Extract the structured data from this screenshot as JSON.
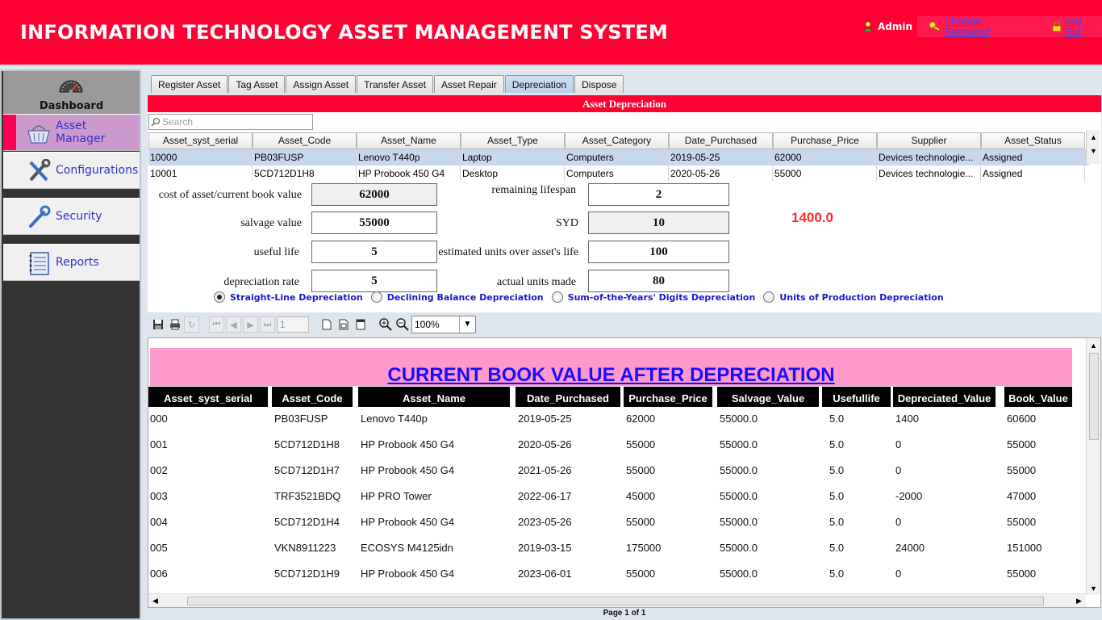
{
  "header": {
    "title": "INFORMATION TECHNOLOGY ASSET MANAGEMENT SYSTEM",
    "user": "Admin",
    "change_password": "Change Password",
    "logout": "Log Out",
    "bg_color": "#ff0033"
  },
  "sidebar": {
    "dashboard": "Dashboard",
    "items": [
      {
        "label": "Asset Manager",
        "icon": "basket-icon",
        "active": true
      },
      {
        "label": "Configurations",
        "icon": "tools-icon",
        "active": false
      },
      {
        "label": "Security",
        "icon": "wrench-icon",
        "active": false
      },
      {
        "label": "Reports",
        "icon": "notebook-icon",
        "active": false
      }
    ]
  },
  "tabs": [
    "Register Asset",
    "Tag Asset",
    "Assign Asset",
    "Transfer Asset",
    "Asset Repair",
    "Depreciation",
    "Dispose"
  ],
  "active_tab": "Depreciation",
  "banner": "Asset Depreciation",
  "search": {
    "placeholder": "Search"
  },
  "asset_table": {
    "columns": [
      "Asset_syst_serial",
      "Asset_Code",
      "Asset_Name",
      "Asset_Type",
      "Asset_Category",
      "Date_Purchased",
      "Purchase_Price",
      "Supplier",
      "Asset_Status"
    ],
    "rows": [
      [
        "10000",
        "PB03FUSP",
        "Lenovo T440p",
        "Laptop",
        "Computers",
        "2019-05-25",
        "62000",
        "Devices technologie...",
        "Assigned"
      ],
      [
        "10001",
        "5CD712D1H8",
        "HP Probook 450 G4",
        "Desktop",
        "Computers",
        "2020-05-26",
        "55000",
        "Devices technologie...",
        "Assigned"
      ]
    ]
  },
  "fields": {
    "cost_label": "cost of asset/current book value",
    "cost_value": "62000",
    "salvage_label": "salvage value",
    "salvage_value": "55000",
    "useful_label": "useful life",
    "useful_value": "5",
    "rate_label": "depreciation rate",
    "rate_value": "5",
    "remaining_label": "remaining lifespan",
    "remaining_value": "2",
    "syd_label": "SYD",
    "syd_value": "10",
    "est_units_label": "estimated units over asset's life",
    "est_units_value": "100",
    "actual_units_label": "actual units made",
    "actual_units_value": "80",
    "result": "1400.0"
  },
  "methods": [
    {
      "label": "Straight-Line Depreciation",
      "selected": true
    },
    {
      "label": "Declining Balance Depreciation",
      "selected": false
    },
    {
      "label": "Sum-of-the-Years' Digits Depreciation",
      "selected": false
    },
    {
      "label": "Units of Production Depreciation",
      "selected": false
    }
  ],
  "viewer": {
    "page_field": "1",
    "zoom": "100%",
    "page_info": "Page 1 of 1"
  },
  "report": {
    "title": "CURRENT BOOK VALUE AFTER DEPRECIATION",
    "title_bg": "#ff99cc",
    "columns": [
      "Asset_syst_serial",
      "Asset_Code",
      "Asset_Name",
      "Date_Purchased",
      "Purchase_Price",
      "Salvage_Value",
      "Usefullife",
      "Depreciated_Value",
      "Book_Value"
    ],
    "rows": [
      [
        "000",
        "PB03FUSP",
        "Lenovo T440p",
        "2019-05-25",
        "62000",
        "55000.0",
        "5.0",
        "1400",
        "60600"
      ],
      [
        "001",
        "5CD712D1H8",
        "HP Probook 450 G4",
        "2020-05-26",
        "55000",
        "55000.0",
        "5.0",
        "0",
        "55000"
      ],
      [
        "002",
        "5CD712D1H7",
        "HP Probook 450 G4",
        "2021-05-26",
        "55000",
        "55000.0",
        "5.0",
        "0",
        "55000"
      ],
      [
        "003",
        "TRF3521BDQ",
        "HP PRO Tower",
        "2022-06-17",
        "45000",
        "55000.0",
        "5.0",
        "-2000",
        "47000"
      ],
      [
        "004",
        "5CD712D1H4",
        "HP Probook 450 G4",
        "2023-05-26",
        "55000",
        "55000.0",
        "5.0",
        "0",
        "55000"
      ],
      [
        "005",
        "VKN8911223",
        "ECOSYS M4125idn",
        "2019-03-15",
        "175000",
        "55000.0",
        "5.0",
        "24000",
        "151000"
      ],
      [
        "006",
        "5CD712D1H9",
        "HP Probook 450 G4",
        "2023-06-01",
        "55000",
        "55000.0",
        "5.0",
        "0",
        "55000"
      ]
    ]
  }
}
